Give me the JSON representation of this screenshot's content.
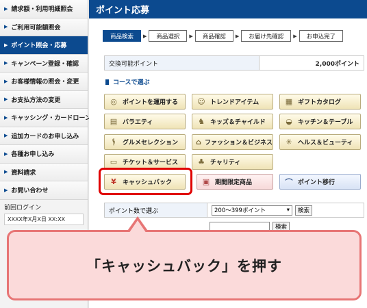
{
  "sidebar": {
    "items": [
      {
        "label": "請求額・利用明細照会"
      },
      {
        "label": "ご利用可能額照会"
      },
      {
        "label": "ポイント照会・応募",
        "active": true
      },
      {
        "label": "キャンペーン登録・確認"
      },
      {
        "label": "お客様情報の照会・変更"
      },
      {
        "label": "お支払方法の変更"
      },
      {
        "label": "キャッシング・カードローン"
      },
      {
        "label": "追加カードのお申し込み"
      },
      {
        "label": "各種お申し込み"
      },
      {
        "label": "資料請求"
      },
      {
        "label": "お問い合わせ"
      }
    ],
    "last_login_label": "前回ログイン",
    "last_login_value": "XXXX年X月X日 XX:XX"
  },
  "main": {
    "title": "ポイント応募",
    "steps": [
      "商品検索",
      "商品選択",
      "商品確認",
      "お届け先確認",
      "お申込完了"
    ],
    "points": {
      "label": "交換可能ポイント",
      "value": "2,000ポイント"
    },
    "course_heading": "コースで選ぶ",
    "courses": [
      {
        "label": "ポイントを運用する",
        "icon": "coins-icon"
      },
      {
        "label": "トレンドアイテム",
        "icon": "people-icon"
      },
      {
        "label": "ギフトカタログ",
        "icon": "gift-icon"
      },
      {
        "label": "バラエティ",
        "icon": "grid-icon"
      },
      {
        "label": "キッズ＆チャイルド",
        "icon": "rocking-horse-icon"
      },
      {
        "label": "キッチン＆テーブル",
        "icon": "pan-icon"
      },
      {
        "label": "グルメセレクション",
        "icon": "fork-knife-icon"
      },
      {
        "label": "ファッション＆ビジネス",
        "icon": "shirt-icon"
      },
      {
        "label": "ヘルス＆ビューティ",
        "icon": "sparkle-icon"
      },
      {
        "label": "チケット＆サービス",
        "icon": "ticket-icon"
      },
      {
        "label": "チャリティ",
        "icon": "sprout-icon"
      }
    ],
    "special": [
      {
        "label": "キャッシュバック",
        "icon": "yen-icon"
      },
      {
        "label": "期間限定商品",
        "icon": "calendar-icon"
      },
      {
        "label": "ポイント移行",
        "icon": "transfer-icon"
      }
    ],
    "filter": {
      "label": "ポイント数で選ぶ",
      "selected": "200～399ポイント",
      "search_button": "検索",
      "row2_button": "検索"
    }
  },
  "callout": {
    "text": "「キャッシュバック」を押す"
  }
}
